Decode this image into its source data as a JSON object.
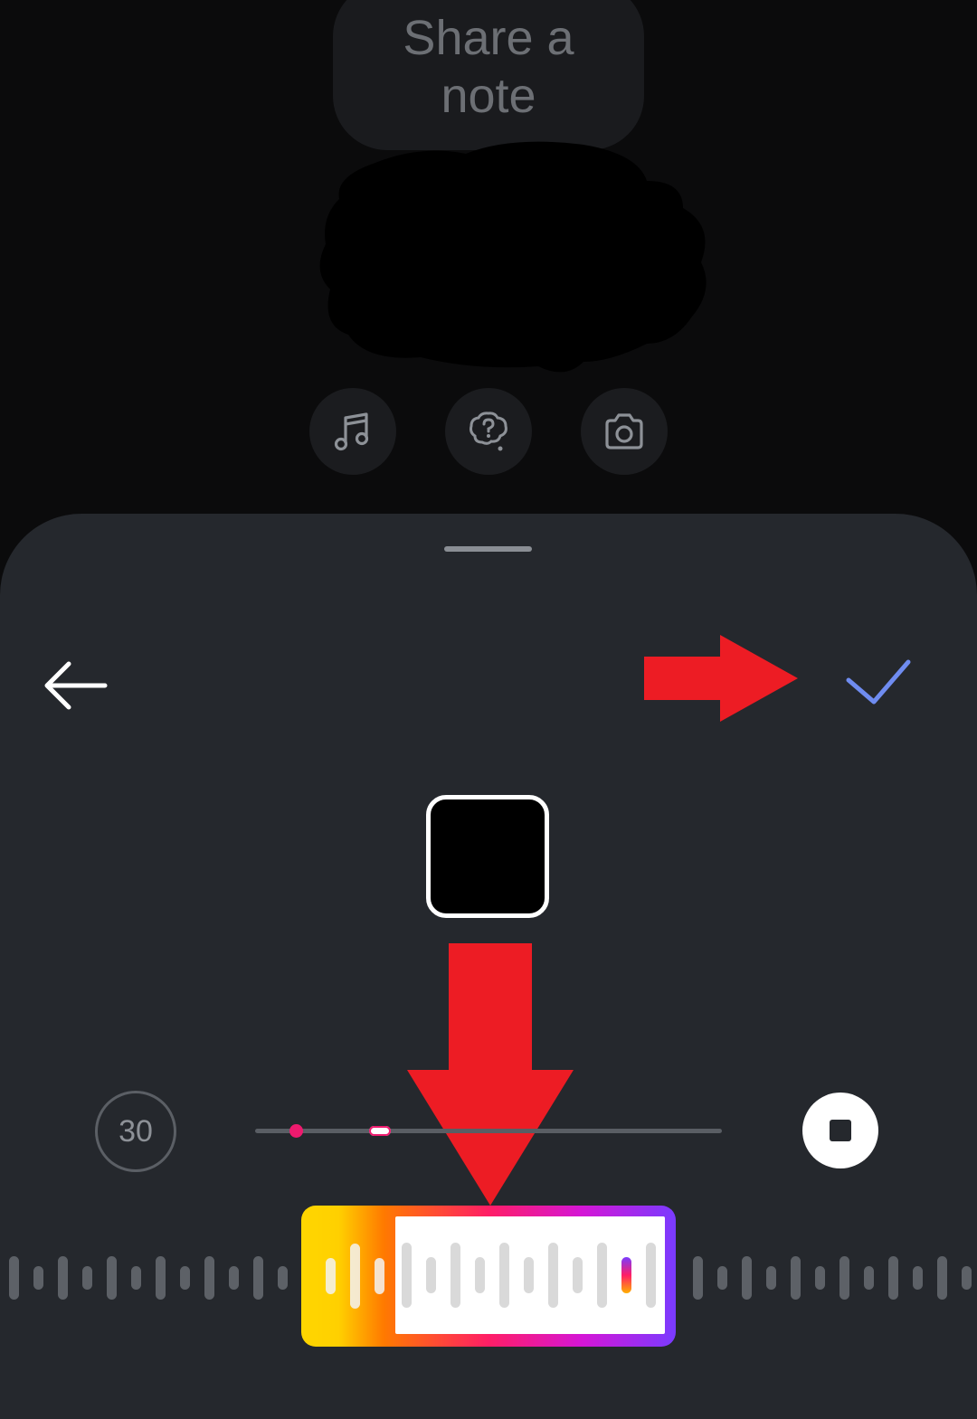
{
  "note": {
    "bubble_text": "Share a note"
  },
  "note_tools": [
    {
      "icon": "music-note-icon"
    },
    {
      "icon": "question-bubble-icon"
    },
    {
      "icon": "camera-icon"
    }
  ],
  "editor": {
    "back_icon": "arrow-left-icon",
    "done_icon": "checkmark-icon",
    "done_color": "#6f8cf0",
    "clip_duration": "30",
    "stop_icon": "stop-icon",
    "progress_fraction": 0.27,
    "accent_colors": {
      "pink": "#ee1a6e",
      "yellow": "#ffd600",
      "purple": "#7a3bff"
    }
  },
  "annotations": {
    "arrow_color": "#ed1c24"
  }
}
